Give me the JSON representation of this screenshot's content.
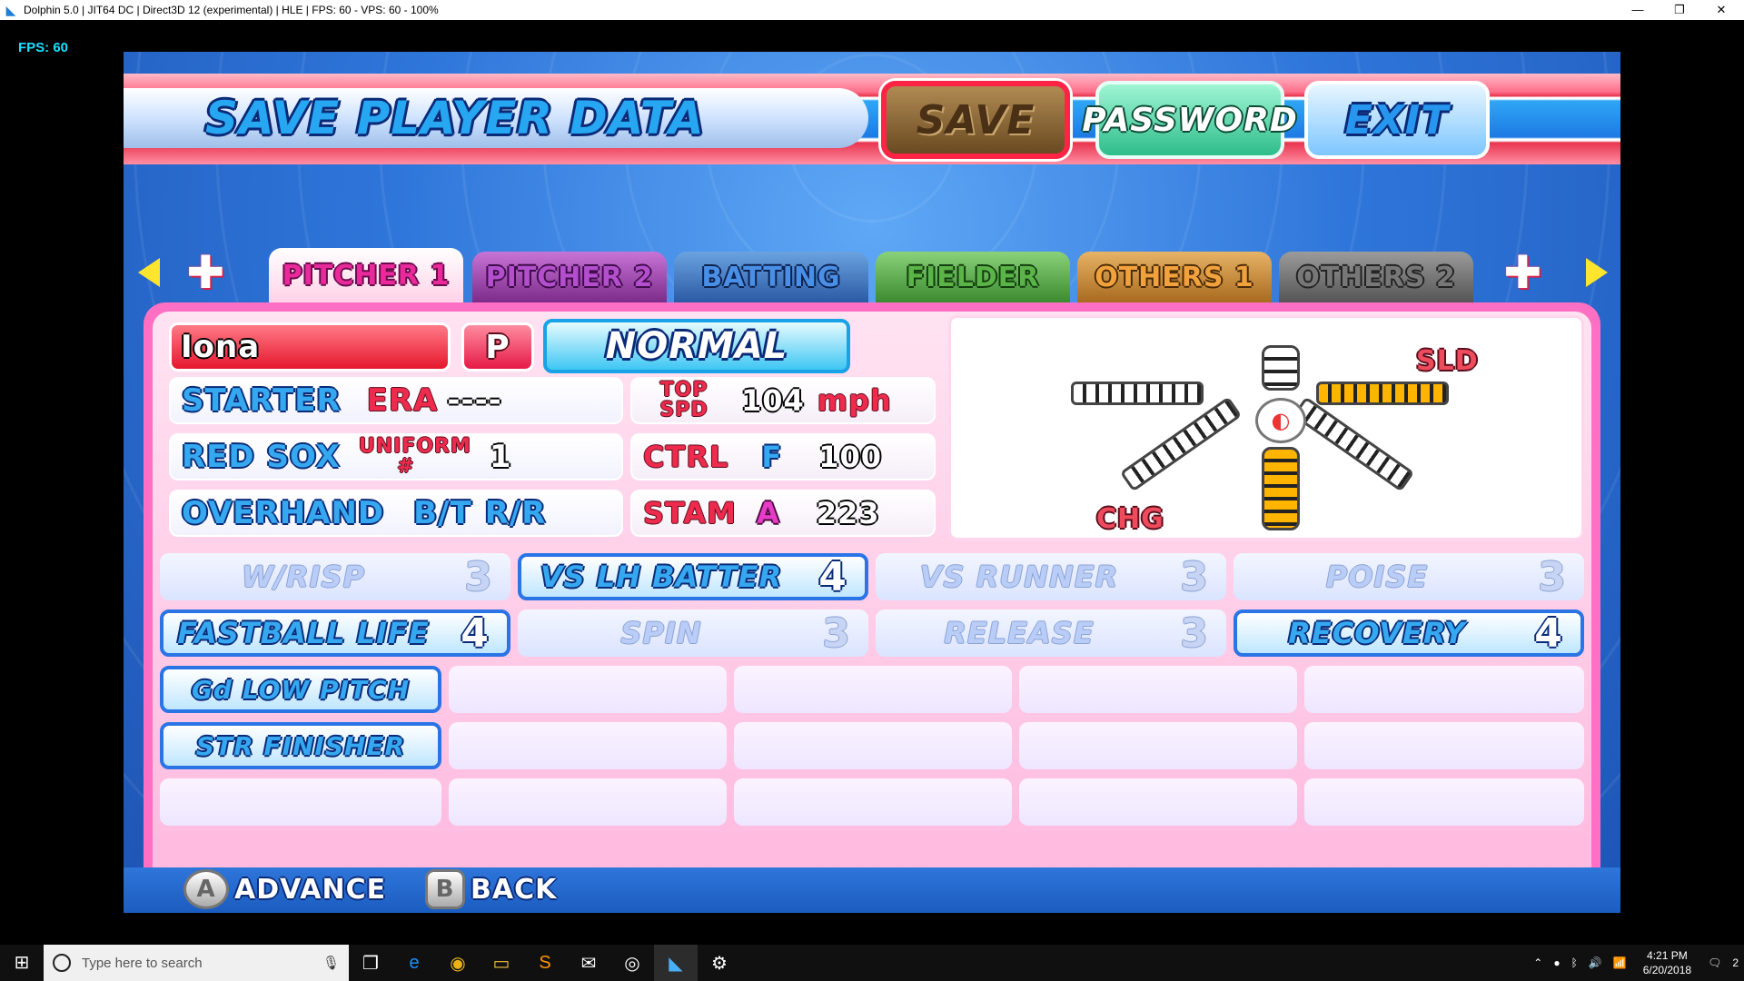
{
  "window": {
    "title": "Dolphin 5.0 | JIT64 DC | Direct3D 12 (experimental) | HLE | FPS: 60 - VPS: 60 - 100%",
    "app_icon": "dolphin-icon",
    "minimize": "—",
    "restore": "❐",
    "close": "✕"
  },
  "overlay": {
    "fps": "FPS: 60"
  },
  "header": {
    "title": "SAVE PLAYER DATA",
    "save_label": "SAVE",
    "password_label": "PASSWORD",
    "exit_label": "EXIT"
  },
  "tabs": [
    {
      "label": "PITCHER 1"
    },
    {
      "label": "PITCHER 2"
    },
    {
      "label": "BATTING"
    },
    {
      "label": "FIELDER"
    },
    {
      "label": "OTHERS 1"
    },
    {
      "label": "OTHERS 2"
    }
  ],
  "player": {
    "name": "Iona",
    "position": "P",
    "condition": "NORMAL",
    "role": "STARTER",
    "era_label": "ERA",
    "era_value": "----",
    "team": "RED SOX",
    "uniform_label": "UNIFORM #",
    "uniform_number": "1",
    "delivery": "OVERHAND",
    "bt_label": "B/T",
    "bt_value": "R/R",
    "top_spd_label": "TOP SPD",
    "top_spd_value": "104",
    "top_spd_unit": "mph",
    "ctrl_label": "CTRL",
    "ctrl_grade": "F",
    "ctrl_value": "100",
    "stam_label": "STAM",
    "stam_grade": "A",
    "stam_value": "223"
  },
  "pitches": {
    "sld_label": "SLD",
    "chg_label": "CHG",
    "ball_icon": "baseball-icon"
  },
  "abilities": {
    "row1": [
      {
        "label": "W/RISP",
        "value": "3"
      },
      {
        "label": "VS LH BATTER",
        "value": "4"
      },
      {
        "label": "VS RUNNER",
        "value": "3"
      },
      {
        "label": "POISE",
        "value": "3"
      }
    ],
    "row2": [
      {
        "label": "FASTBALL LIFE",
        "value": "4"
      },
      {
        "label": "SPIN",
        "value": "3"
      },
      {
        "label": "RELEASE",
        "value": "3"
      },
      {
        "label": "RECOVERY",
        "value": "4"
      }
    ],
    "special": [
      {
        "label": "Gd LOW PITCH"
      },
      {
        "label": "STR FINISHER"
      }
    ]
  },
  "controls": {
    "a_key": "A",
    "a_label": "ADVANCE",
    "b_key": "B",
    "b_label": "BACK"
  },
  "taskbar": {
    "search_placeholder": "Type here to search",
    "time": "4:21 PM",
    "date": "6/20/2018",
    "notifications": "2"
  }
}
